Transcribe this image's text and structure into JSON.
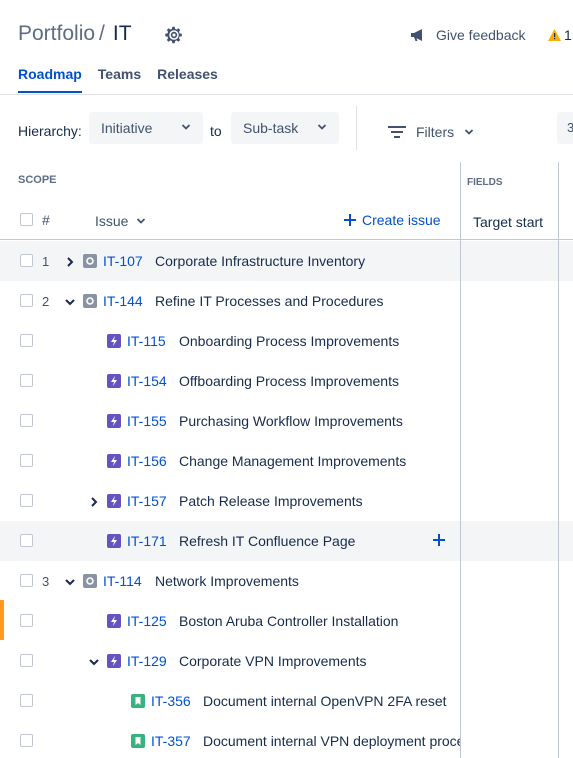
{
  "header": {
    "breadcrumb_parent": "Portfolio",
    "breadcrumb_sep": "/",
    "breadcrumb_current": "IT",
    "feedback_label": "Give feedback",
    "warning_count": "1",
    "tabs": [
      {
        "label": "Roadmap",
        "active": true
      },
      {
        "label": "Teams",
        "active": false
      },
      {
        "label": "Releases",
        "active": false
      }
    ]
  },
  "toolbar": {
    "hierarchy_label": "Hierarchy:",
    "hierarchy_from": "Initiative",
    "to_label": "to",
    "hierarchy_to": "Sub-task",
    "filters_label": "Filters",
    "right_value": "3"
  },
  "columns": {
    "scope_label": "SCOPE",
    "fields_label": "FIELDS",
    "hash": "#",
    "issue_label": "Issue",
    "create_label": "Create issue",
    "target_start": "Target start"
  },
  "icons": {
    "initiative": "initiative-icon",
    "epic": "epic-icon",
    "story": "story-icon"
  },
  "colors": {
    "accent": "#0052cc",
    "epic": "#6554c0",
    "story": "#36b37e",
    "initiative": "#8993a4",
    "marker": "#ff991f"
  },
  "rows": [
    {
      "num": "1",
      "key": "IT-107",
      "title": "Corporate Infrastructure Inventory",
      "type": "initiative",
      "level": 0,
      "expander": "collapsed"
    },
    {
      "num": "2",
      "key": "IT-144",
      "title": "Refine IT Processes and Procedures",
      "type": "initiative",
      "level": 0,
      "expander": "expanded"
    },
    {
      "num": "",
      "key": "IT-115",
      "title": "Onboarding Process Improvements",
      "type": "epic",
      "level": 1,
      "expander": "none"
    },
    {
      "num": "",
      "key": "IT-154",
      "title": "Offboarding Process Improvements",
      "type": "epic",
      "level": 1,
      "expander": "none"
    },
    {
      "num": "",
      "key": "IT-155",
      "title": "Purchasing Workflow Improvements",
      "type": "epic",
      "level": 1,
      "expander": "none"
    },
    {
      "num": "",
      "key": "IT-156",
      "title": "Change Management Improvements",
      "type": "epic",
      "level": 1,
      "expander": "none"
    },
    {
      "num": "",
      "key": "IT-157",
      "title": "Patch Release Improvements",
      "type": "epic",
      "level": 1,
      "expander": "collapsed"
    },
    {
      "num": "",
      "key": "IT-171",
      "title": "Refresh IT Confluence Page",
      "type": "epic",
      "level": 1,
      "expander": "none",
      "hover": true
    },
    {
      "num": "3",
      "key": "IT-114",
      "title": "Network Improvements",
      "type": "initiative",
      "level": 0,
      "expander": "expanded"
    },
    {
      "num": "",
      "key": "IT-125",
      "title": "Boston Aruba Controller Installation",
      "type": "epic",
      "level": 1,
      "expander": "none",
      "marked": true
    },
    {
      "num": "",
      "key": "IT-129",
      "title": "Corporate VPN Improvements",
      "type": "epic",
      "level": 1,
      "expander": "expanded"
    },
    {
      "num": "",
      "key": "IT-356",
      "title": "Document internal OpenVPN 2FA reset",
      "type": "story",
      "level": 2,
      "expander": "none"
    },
    {
      "num": "",
      "key": "IT-357",
      "title": "Document internal VPN deployment process",
      "type": "story",
      "level": 2,
      "expander": "none"
    }
  ]
}
